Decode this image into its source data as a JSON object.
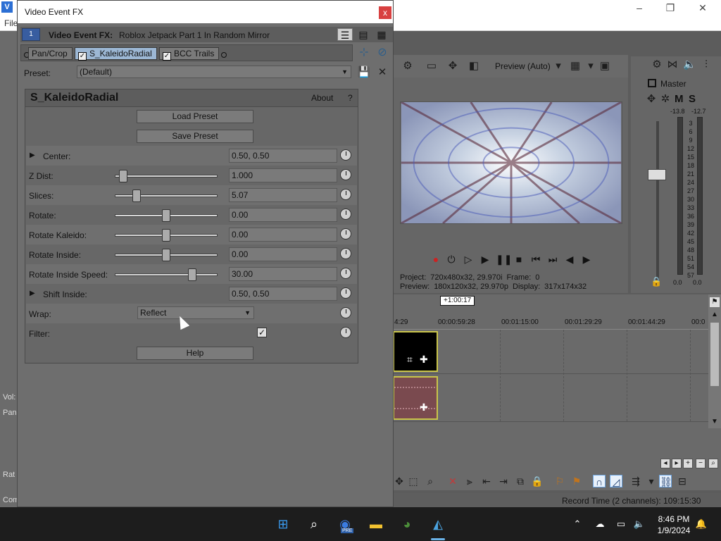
{
  "app": {
    "menu_first": "File",
    "logo_letter": "V",
    "left_fragments": [
      "Vol:",
      "Pan",
      "Rat",
      "Com"
    ]
  },
  "dialog": {
    "title": "Video Event FX",
    "close_label": "x",
    "fx_index": "1",
    "fx_title_label": "Video Event FX:",
    "fx_title_value": "Roblox Jetpack Part 1 In Random Mirror",
    "chain": [
      {
        "label": "Pan/Crop",
        "checked": false
      },
      {
        "label": "S_KaleidoRadial",
        "checked": true
      },
      {
        "label": "BCC Trails",
        "checked": true
      }
    ],
    "preset_label": "Preset:",
    "preset_value": "(Default)"
  },
  "plugin": {
    "name": "S_KaleidoRadial",
    "about": "About",
    "help_q": "?",
    "load_preset": "Load Preset",
    "save_preset": "Save Preset",
    "help": "Help",
    "params": [
      {
        "label": "Center:",
        "value": "0.50, 0.50",
        "expandable": true
      },
      {
        "label": "Z Dist:",
        "value": "1.000",
        "slider": 0.08
      },
      {
        "label": "Slices:",
        "value": "5.07",
        "slider": 0.21
      },
      {
        "label": "Rotate:",
        "value": "0.00",
        "slider": 0.5
      },
      {
        "label": "Rotate Kaleido:",
        "value": "0.00",
        "slider": 0.5
      },
      {
        "label": "Rotate Inside:",
        "value": "0.00",
        "slider": 0.5
      },
      {
        "label": "Rotate Inside Speed:",
        "value": "30.00",
        "slider": 0.75
      },
      {
        "label": "Shift Inside:",
        "value": "0.50, 0.50",
        "expandable": true
      }
    ],
    "wrap_label": "Wrap:",
    "wrap_value": "Reflect",
    "filter_label": "Filter:",
    "filter_checked": true
  },
  "preview": {
    "quality": "Preview (Auto)",
    "project_label": "Project:",
    "project_value": "720x480x32, 29.970i",
    "frame_label": "Frame:",
    "frame_value": "0",
    "preview_label": "Preview:",
    "preview_value": "180x120x32, 29.970p",
    "display_label": "Display:",
    "display_value": "317x174x32"
  },
  "master": {
    "label": "Master",
    "m": "M",
    "s": "S",
    "peak_left": "-13.8",
    "peak_right": "-12.7",
    "scale": [
      "3",
      "6",
      "9",
      "12",
      "15",
      "18",
      "21",
      "24",
      "27",
      "30",
      "33",
      "36",
      "39",
      "42",
      "45",
      "48",
      "51",
      "54",
      "57"
    ],
    "bottom_left": "0.0",
    "bottom_right": "0.0"
  },
  "timeline": {
    "cursor_time": "+1:00:17",
    "ruler": [
      "4:29",
      "00:00:59:28",
      "00:01:15:00",
      "00:01:29:29",
      "00:01:44:29",
      "00:0"
    ]
  },
  "status": {
    "record_time": "Record Time (2 channels): 109:15:30"
  },
  "taskbar": {
    "time": "8:46 PM",
    "date": "1/9/2024",
    "pre_badge": "PRE"
  }
}
